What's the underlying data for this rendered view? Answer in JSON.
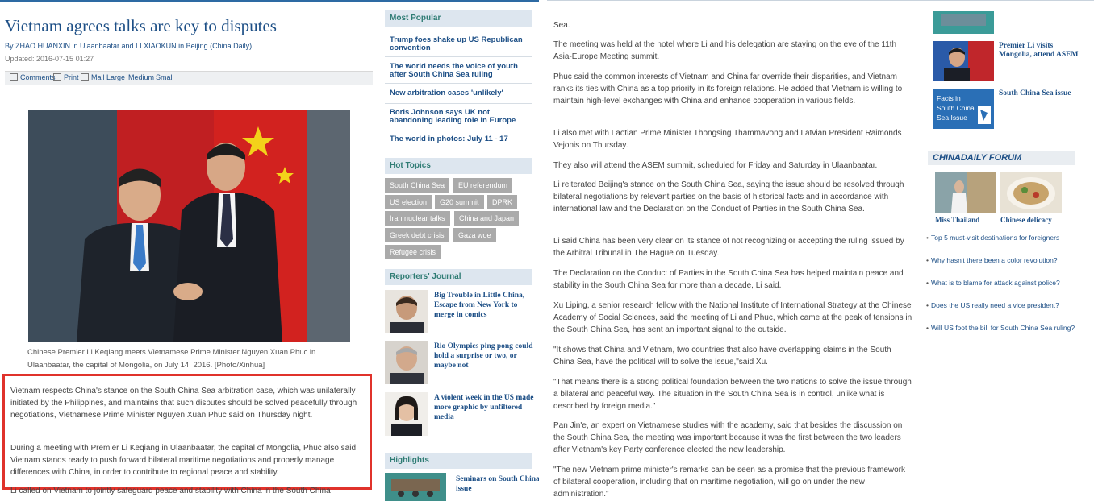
{
  "article": {
    "title": "Vietnam agrees talks are key to disputes",
    "byline": "By ZHAO HUANXIN in Ulaanbaatar and LI XIAOKUN in Beijing (China Daily)",
    "updated": "Updated: 2016-07-15 01:27",
    "toolbar": {
      "comments": "Comments",
      "print": "Print",
      "mail": "Mail",
      "large": "Large",
      "medium": "Medium",
      "small": "Small"
    },
    "photo_caption": "Chinese Premier Li Keqiang meets Vietnamese Prime Minister Nguyen Xuan Phuc in Ulaanbaatar, the capital of Mongolia, on July 14, 2016. [Photo/Xinhua]",
    "para1": "Vietnam respects China's stance on the South China Sea arbitration case, which was unilaterally initiated by the Philippines, and maintains that such disputes should be solved peacefully through negotiations, Vietnamese Prime Minister Nguyen Xuan Phuc said on Thursday night.",
    "para2": "During a meeting with Premier Li Keqiang in Ulaanbaatar, the capital of Mongolia, Phuc also said Vietnam stands ready to push forward bilateral maritime negotiations and properly manage differences with China, in order to contribute to regional peace and stability.",
    "para3_cut": "Li called on Vietnam to jointly safeguard peace and stability with China in the South China"
  },
  "most_popular": {
    "heading": "Most Popular",
    "items": [
      "Trump foes shake up US Republican convention",
      "The world needs the voice of youth after South China Sea ruling",
      "New arbitration cases 'unlikely'",
      "Boris Johnson says UK not abandoning leading role in Europe",
      "The world in photos: July 11 - 17"
    ]
  },
  "hot_topics": {
    "heading": "Hot Topics",
    "tags": [
      "South China Sea",
      "EU referendum",
      "US election",
      "G20 summit",
      "DPRK",
      "Iran nuclear talks",
      "China and Japan",
      "Greek debt crisis",
      "Gaza woe",
      "Refugee crisis"
    ]
  },
  "reporters": {
    "heading": "Reporters' Journal",
    "items": [
      "Big Trouble in Little China, Escape from New York to merge in comics",
      "Rio Olympics ping pong could hold a surprise or two, or maybe not",
      "A violent week in the US made more graphic by unfiltered media"
    ]
  },
  "highlights": {
    "heading": "Highlights",
    "items": [
      "Seminars on South China Sea issue"
    ]
  },
  "right": {
    "lead": "Sea.",
    "paragraphs": [
      "The meeting was held at the hotel where Li and his delegation are staying on the eve of the 11th Asia-Europe Meeting summit.",
      "Phuc said the common interests of Vietnam and China far override their disparities, and Vietnam ranks its ties with China as a top priority in its foreign relations. He added that Vietnam is willing to maintain high-level exchanges with China and enhance cooperation in various fields.",
      "Li also met with Laotian Prime Minister Thongsing Thammavong and Latvian President Raimonds Vejonis on Thursday.",
      "They also will attend the ASEM summit, scheduled for Friday and Saturday in Ulaanbaatar.",
      "Li reiterated Beijing's stance on the South China Sea, saying the issue should be resolved through bilateral negotiations by relevant parties on the basis of historical facts and in accordance with international law and the Declaration on the Conduct of Parties in the South China Sea.",
      "Li said China has been very clear on its stance of not recognizing or accepting the ruling issued by the Arbitral Tribunal in The Hague on Tuesday.",
      "The Declaration on the Conduct of Parties in the South China Sea has helped maintain peace and stability in the South China Sea for more than a decade, Li said.",
      "Xu Liping, a senior research fellow with the National Institute of International Strategy at the Chinese Academy of Social Sciences, said the meeting of Li and Phuc, which came at the peak of tensions in the South China Sea, has sent an important signal to the outside.",
      "\"It shows that China and Vietnam, two countries that also have overlapping claims in the South China Sea, have the political will to solve the issue,\"said Xu.",
      "\"That means there is a strong political foundation between the two nations to solve the issue through a bilateral and peaceful way. The situation in the South China Sea is in control, unlike what is described by foreign media.\"",
      "Pan Jin'e, an expert on Vietnamese studies with the academy, said that besides the discussion on the South China Sea, the meeting was important because it was the first between the two leaders after Vietnam's key Party conference elected the new leadership.",
      "\"The new Vietnam prime minister's remarks can be seen as a promise that the previous framework of bilateral cooperation, including that on maritime negotiation, will go on under the new administration.\""
    ],
    "side_items": [
      "Premier Li visits Mongolia, attend ASEM",
      "South China Sea issue"
    ],
    "facts_badge": "Facts in South China Sea Issue",
    "forum": {
      "logo": "CHINADAILY FORUM",
      "captions": [
        "Miss Thailand",
        "Chinese delicacy"
      ],
      "links": [
        "Top 5 must-visit destinations for foreigners",
        "Why hasn't there been a color revolution?",
        "What is to blame for attack against police?",
        "Does the US really need a vice president?",
        "Will US foot the bill for South China Sea ruling?"
      ]
    }
  }
}
